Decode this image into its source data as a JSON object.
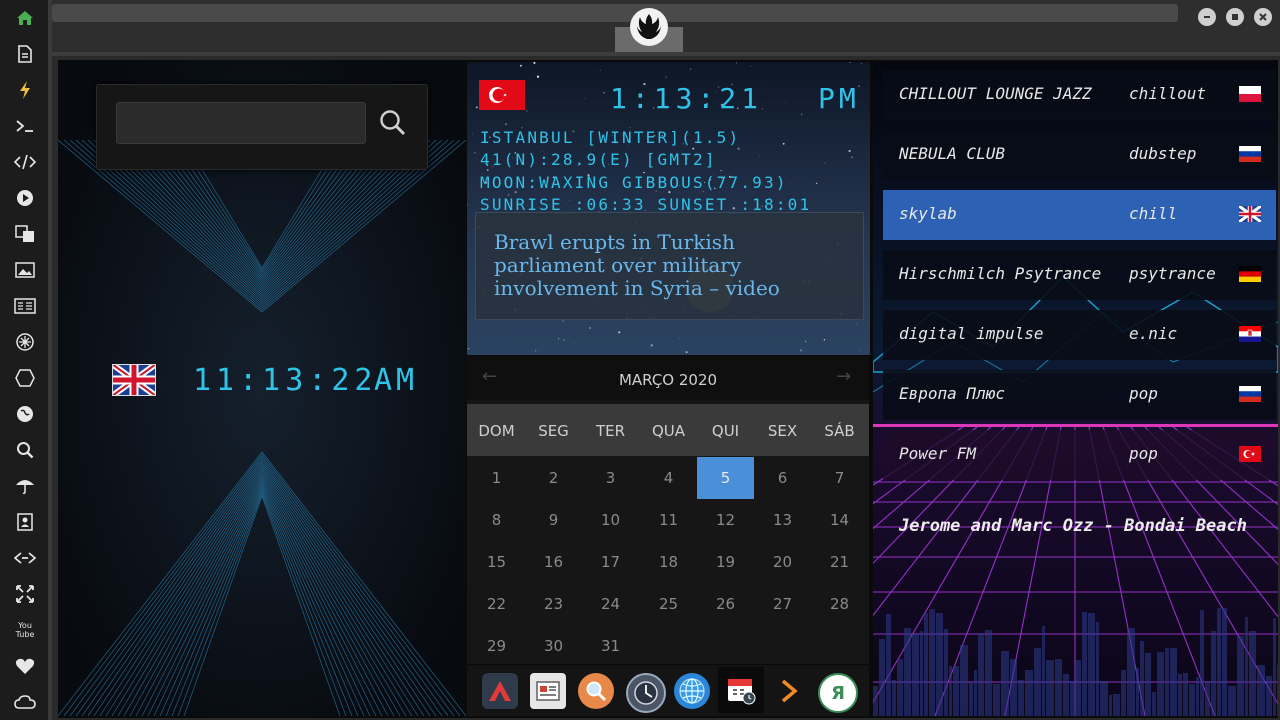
{
  "sidebar": {
    "items": [
      {
        "icon": "home-icon"
      },
      {
        "icon": "document-icon"
      },
      {
        "icon": "lightning-icon"
      },
      {
        "icon": "terminal-icon"
      },
      {
        "icon": "code-icon"
      },
      {
        "icon": "play-icon"
      },
      {
        "icon": "translate-icon"
      },
      {
        "icon": "image-icon"
      },
      {
        "icon": "news-icon"
      },
      {
        "icon": "settings-icon"
      },
      {
        "icon": "hexagon-icon"
      },
      {
        "icon": "globe-icon"
      },
      {
        "icon": "search-icon"
      },
      {
        "icon": "umbrella-icon"
      },
      {
        "icon": "contacts-icon"
      },
      {
        "icon": "link-icon"
      },
      {
        "icon": "expand-icon"
      },
      {
        "icon": "youtube-icon",
        "label": "You Tube"
      },
      {
        "icon": "heart-icon"
      },
      {
        "icon": "cloud-icon"
      }
    ]
  },
  "window": {
    "controls": [
      "minimize",
      "maximize",
      "close"
    ]
  },
  "search": {
    "value": "",
    "placeholder": ""
  },
  "clock_uk": {
    "time": "11:13:22",
    "ampm": "AM",
    "flag": "UK"
  },
  "clock_tr": {
    "time": "1:13:21",
    "ampm": "PM",
    "flag": "Turkey",
    "lines": [
      "ISTANBUL [WINTER](1.5)",
      "41(N):28.9(E) [GMT2]",
      "MOON:WAXING GIBBOUS(77.93)",
      "SUNRISE_:06:33 SUNSET_:18:01"
    ]
  },
  "news": {
    "headline": "Brawl erupts in Turkish parliament over military involvement in Syria – video"
  },
  "calendar": {
    "month": "MARÇO 2020",
    "prev": "←",
    "next": "→",
    "weekdays": [
      "DOM",
      "SEG",
      "TER",
      "QUA",
      "QUI",
      "SEX",
      "SÁB"
    ],
    "weeks": [
      [
        "1",
        "2",
        "3",
        "4",
        "5",
        "6",
        "7"
      ],
      [
        "8",
        "9",
        "10",
        "11",
        "12",
        "13",
        "14"
      ],
      [
        "15",
        "16",
        "17",
        "18",
        "19",
        "20",
        "21"
      ],
      [
        "22",
        "23",
        "24",
        "25",
        "26",
        "27",
        "28"
      ],
      [
        "29",
        "30",
        "31",
        "",
        "",
        "",
        ""
      ]
    ],
    "today": "5"
  },
  "dock": {
    "apps": [
      "apex-icon",
      "newspaper-icon",
      "search-app-icon",
      "clock-app-icon",
      "browser-icon",
      "calendar-app-icon",
      "next-icon",
      "yandex-icon"
    ],
    "yandex_letter": "Я"
  },
  "radio": {
    "stations": [
      {
        "name": "CHILLOUT LOUNGE JAZZ",
        "genre": "chillout",
        "flag": "Poland"
      },
      {
        "name": "NEBULA CLUB",
        "genre": "dubstep",
        "flag": "Russia"
      },
      {
        "name": "skylab",
        "genre": "chill",
        "flag": "UK"
      },
      {
        "name": "Hirschmilch Psytrance",
        "genre": "psytrance",
        "flag": "Germany"
      },
      {
        "name": "digital impulse",
        "genre": "e.nic",
        "flag": "Croatia"
      },
      {
        "name": "Европа Плюс",
        "genre": "pop",
        "flag": "Russia"
      },
      {
        "name": "Power FM",
        "genre": "pop",
        "flag": "Turkey"
      }
    ],
    "now_playing": "Jerome and Marc Ozz - Bondai Beach"
  },
  "colors": {
    "accent": "#2fc3e8",
    "selected_station": "#2d61b3",
    "today": "#4a8fd8",
    "sidebar_home": "#4caf50"
  }
}
